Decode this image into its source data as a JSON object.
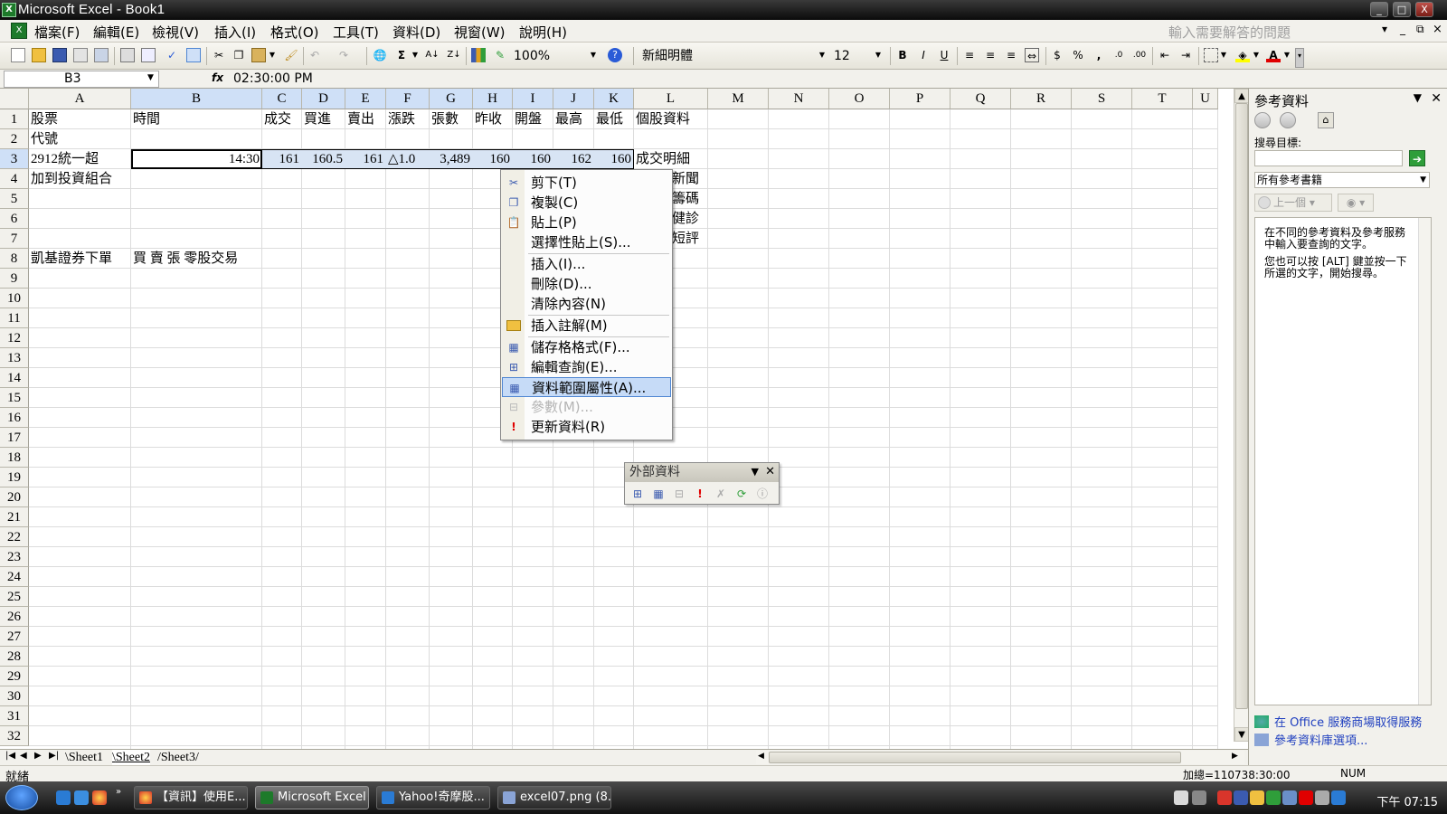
{
  "window": {
    "title": "Microsoft Excel - Book1",
    "app_icon": "excel-icon",
    "controls": [
      "_",
      "□",
      "X"
    ]
  },
  "menu": {
    "items": [
      "檔案(F)",
      "編輯(E)",
      "檢視(V)",
      "插入(I)",
      "格式(O)",
      "工具(T)",
      "資料(D)",
      "視窗(W)",
      "說明(H)"
    ],
    "help_placeholder": "輸入需要解答的問題",
    "doc_controls": [
      "▾",
      "_",
      "⧉",
      "×"
    ]
  },
  "toolbar": {
    "zoom": "100%",
    "font": "新細明體",
    "font_size": "12",
    "bold": "B",
    "italic": "I",
    "underline": "U",
    "currency": "$",
    "percent": "%",
    "comma": ","
  },
  "formula_bar": {
    "name_box": "B3",
    "fx": "fx",
    "formula": "02:30:00 PM"
  },
  "sheet": {
    "columns": [
      "A",
      "B",
      "C",
      "D",
      "E",
      "F",
      "G",
      "H",
      "I",
      "J",
      "K",
      "L",
      "M",
      "N",
      "O",
      "P",
      "Q",
      "R",
      "S",
      "T",
      "U"
    ],
    "rows": [
      "1",
      "2",
      "3",
      "4",
      "5",
      "6",
      "7",
      "8",
      "9",
      "10",
      "11",
      "12",
      "13",
      "14",
      "15",
      "16",
      "17",
      "18",
      "19",
      "20",
      "21",
      "22",
      "23",
      "24",
      "25",
      "26",
      "27",
      "28",
      "29",
      "30",
      "31",
      "32"
    ],
    "cells": {
      "a1": "股票",
      "b1": "時間",
      "c1": "成交",
      "d1": "買進",
      "e1": "賣出",
      "f1": "漲跌",
      "g1": "張數",
      "h1": "昨收",
      "i1": "開盤",
      "j1": "最高",
      "k1": "最低",
      "l1": "個股資料",
      "a2": "代號",
      "a3": "2912統一超",
      "b3": "14:30",
      "c3": "161",
      "d3": "160.5",
      "e3": "161",
      "f3": "△1.0",
      "g3": "3,489",
      "h3": "160",
      "i3": "160",
      "j3": "162",
      "k3": "160",
      "l3": "成交明細",
      "a4": "加到投資組合",
      "l4": "新聞",
      "l5": "籌碼",
      "l6": "健診",
      "l7": "短評",
      "a8": "凱基證券下單",
      "b8": "買 賣 張 零股交易"
    },
    "tabs": [
      "Sheet1",
      "Sheet2",
      "Sheet3"
    ]
  },
  "context_menu": {
    "items": [
      {
        "label": "剪下(T)",
        "icon": "scissors-icon",
        "glyph": "✂"
      },
      {
        "label": "複製(C)",
        "icon": "copy-icon",
        "glyph": "❐"
      },
      {
        "label": "貼上(P)",
        "icon": "paste-icon",
        "glyph": "📋"
      },
      {
        "label": "選擇性貼上(S)...",
        "icon": "",
        "glyph": ""
      },
      {
        "label": "插入(I)...",
        "icon": "",
        "glyph": ""
      },
      {
        "label": "刪除(D)...",
        "icon": "",
        "glyph": ""
      },
      {
        "label": "清除內容(N)",
        "icon": "",
        "glyph": ""
      },
      {
        "label": "插入註解(M)",
        "icon": "folder-icon",
        "glyph": "▭"
      },
      {
        "label": "儲存格格式(F)...",
        "icon": "format-cells-icon",
        "glyph": "▦"
      },
      {
        "label": "編輯查詢(E)...",
        "icon": "edit-query-icon",
        "glyph": "⊞"
      },
      {
        "label": "資料範圍屬性(A)...",
        "icon": "data-range-icon",
        "glyph": "▦"
      },
      {
        "label": "參數(M)...",
        "icon": "parameters-icon",
        "glyph": "⊟"
      },
      {
        "label": "更新資料(R)",
        "icon": "refresh-data-icon",
        "glyph": "!"
      }
    ]
  },
  "external_data_toolbar": {
    "title": "外部資料"
  },
  "task_pane": {
    "title": "參考資料",
    "search_label": "搜尋目標:",
    "search_value": "",
    "scope": "所有參考書籍",
    "prev": "上一個",
    "message1": "在不同的參考資料及參考服務中輸入要查詢的文字。",
    "message2": "您也可以按 [ALT] 鍵並按一下所選的文字，開始搜尋。",
    "link1": "在 Office 服務商場取得服務",
    "link2": "參考資料庫選項..."
  },
  "status": {
    "left": "就緒",
    "sum": "加總=110738:30:00",
    "mode": "NUM"
  },
  "taskbar": {
    "tasks": [
      "【資訊】使用E...",
      "Microsoft Excel ...",
      "Yahoo!奇摩股...",
      "excel07.png (8..."
    ],
    "clock": "下午 07:15"
  },
  "colors": {
    "selection": "#d8e4f4",
    "highlight_menu": "#c6dbf7",
    "excel_green": "#1d7a2a"
  }
}
